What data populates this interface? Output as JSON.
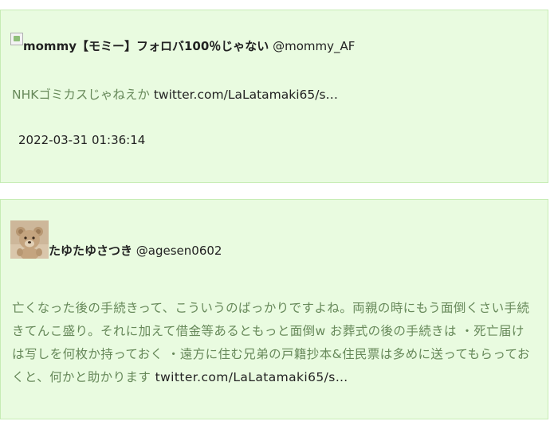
{
  "tweets": [
    {
      "display_name": "mommy【モミー】フォロバ100％じゃない",
      "handle": "@mommy_AF",
      "text": "NHKゴミカスじゃねえか",
      "link": "twitter.com/LaLatamaki65/s…",
      "timestamp": "2022-03-31 01:36:14"
    },
    {
      "display_name": "たゆたゆさつき",
      "handle": "@agesen0602",
      "text": "亡くなった後の手続きって、こういうのばっかりですよね。両親の時にもう面倒くさい手続きてんこ盛り。それに加えて借金等あるともっと面倒w お葬式の後の手続きは ・死亡届けは写しを何枚か持っておく ・遠方に住む兄弟の戸籍抄本&住民票は多めに送ってもらっておくと、何かと助かります",
      "link": "twitter.com/LaLatamaki65/s…"
    }
  ],
  "colors": {
    "card_bg": "#e9fbe0",
    "card_border": "#c6ecb4",
    "tweet_text": "#67895a",
    "link_text": "#222222"
  }
}
